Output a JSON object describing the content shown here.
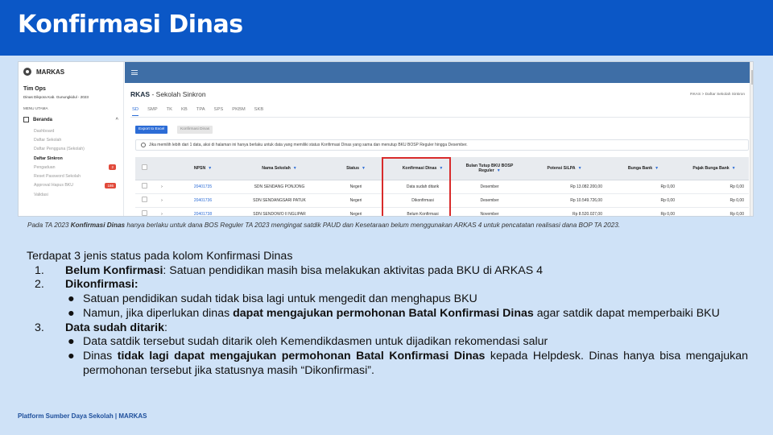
{
  "slide": {
    "title": "Konfirmasi Dinas",
    "caption_pre": "Pada TA 2023 ",
    "caption_bold": "Konfirmasi Dinas",
    "caption_post": " hanya berlaku untuk dana BOS Reguler TA 2023 mengingat satdik PAUD dan Kesetaraan belum menggunakan ARKAS 4 untuk pencatatan realisasi dana BOP TA 2023.",
    "intro": "Terdapat 3 jenis status pada kolom Konfirmasi Dinas",
    "items": [
      {
        "num": "1.",
        "bold": "Belum Konfirmasi",
        "text": ": Satuan pendidikan masih bisa melakukan aktivitas pada BKU di ARKAS 4"
      },
      {
        "num": "2.",
        "bold": "Dikonfirmasi:",
        "bullets": [
          {
            "text1": "Satuan pendidikan sudah tidak bisa lagi untuk mengedit dan menghapus BKU"
          },
          {
            "text1": "Namun, jika diperlukan dinas ",
            "bold": "dapat mengajukan permohonan Batal Konfirmasi Dinas",
            "text2": " agar satdik dapat memperbaiki BKU"
          }
        ]
      },
      {
        "num": "3.",
        "bold": "Data sudah ditarik",
        "text": ":",
        "bullets": [
          {
            "text1": "Data satdik tersebut sudah ditarik oleh Kemendikdasmen untuk dijadikan rekomendasi salur"
          },
          {
            "text1": "Dinas ",
            "bold": "tidak lagi dapat mengajukan permohonan Batal Konfirmasi Dinas",
            "text2": " kepada Helpdesk. Dinas hanya bisa mengajukan permohonan tersebut jika statusnya masih “Dikonfirmasi”."
          }
        ]
      }
    ],
    "bullet_char": "●",
    "footer": "Platform Sumber Daya Sekolah | MARKAS"
  },
  "app": {
    "logo_text": "MARKAS",
    "user_name": "Tim Ops",
    "user_org": "Dinas Dikpora Kab. Gunungkidul - 2023",
    "menu_heading": "MENU UTAMA",
    "menu_beranda": "Beranda",
    "sidebar_items": [
      {
        "label": "Dashboard",
        "active": false,
        "badge": ""
      },
      {
        "label": "Daftar Sekolah",
        "active": false,
        "badge": ""
      },
      {
        "label": "Daftar Pengguna (Sekolah)",
        "active": false,
        "badge": ""
      },
      {
        "label": "Daftar Sinkron",
        "active": true,
        "badge": ""
      },
      {
        "label": "Pengaduan",
        "active": false,
        "badge": "2"
      },
      {
        "label": "Reset Password Sekolah",
        "active": false,
        "badge": ""
      },
      {
        "label": "Approval Hapus BKU",
        "active": false,
        "badge": "186"
      },
      {
        "label": "Validasi",
        "active": false,
        "badge": ""
      }
    ],
    "page_title_bold": "RKAS",
    "page_title_rest": " - Sekolah Sinkron",
    "breadcrumb": "RKAS  >  Daftar Sekolah Sinkron",
    "tabs": [
      "SD",
      "SMP",
      "TK",
      "KB",
      "TPA",
      "SPS",
      "PKBM",
      "SKB"
    ],
    "active_tab": "SD",
    "export_label": "Export to Excel",
    "konfirmasi_label": "Konfirmasi Dinas",
    "info_text": "Jika memilih lebih dari 1 data, aksi di halaman ini hanya berlaku untuk data yang memiliki status Konfirmasi Dinas yang sama dan menutup BKU BOSP Reguler hingga Desember.",
    "columns": [
      "NPSN",
      "Nama Sekolah",
      "Status",
      "Konfirmasi Dinas",
      "Bulan Tutup BKU BOSP Reguler",
      "Potensi SiLPA",
      "Bunga Bank",
      "Pajak Bunga Bank"
    ],
    "rows": [
      {
        "npsn": "20401735",
        "nama": "SDN SENDANG PONJONG",
        "status": "Negeri",
        "konfirmasi": "Data sudah ditarik",
        "bulan": "Desember",
        "silpa": "Rp 13.082.200,00",
        "bunga": "Rp 0,00",
        "pajak": "Rp 0,00"
      },
      {
        "npsn": "20401736",
        "nama": "SDN SENDANGSARI PATUK",
        "status": "Negeri",
        "konfirmasi": "Dikonfirmasi",
        "bulan": "Desember",
        "silpa": "Rp 10.549.726,00",
        "bunga": "Rp 0,00",
        "pajak": "Rp 0,00"
      },
      {
        "npsn": "20401738",
        "nama": "SDN SENDOWO II NGLIPAR",
        "status": "Negeri",
        "konfirmasi": "Belum Konfirmasi",
        "bulan": "November",
        "silpa": "Rp 8.520.027,00",
        "bunga": "Rp 0,00",
        "pajak": "Rp 0,00"
      }
    ]
  }
}
